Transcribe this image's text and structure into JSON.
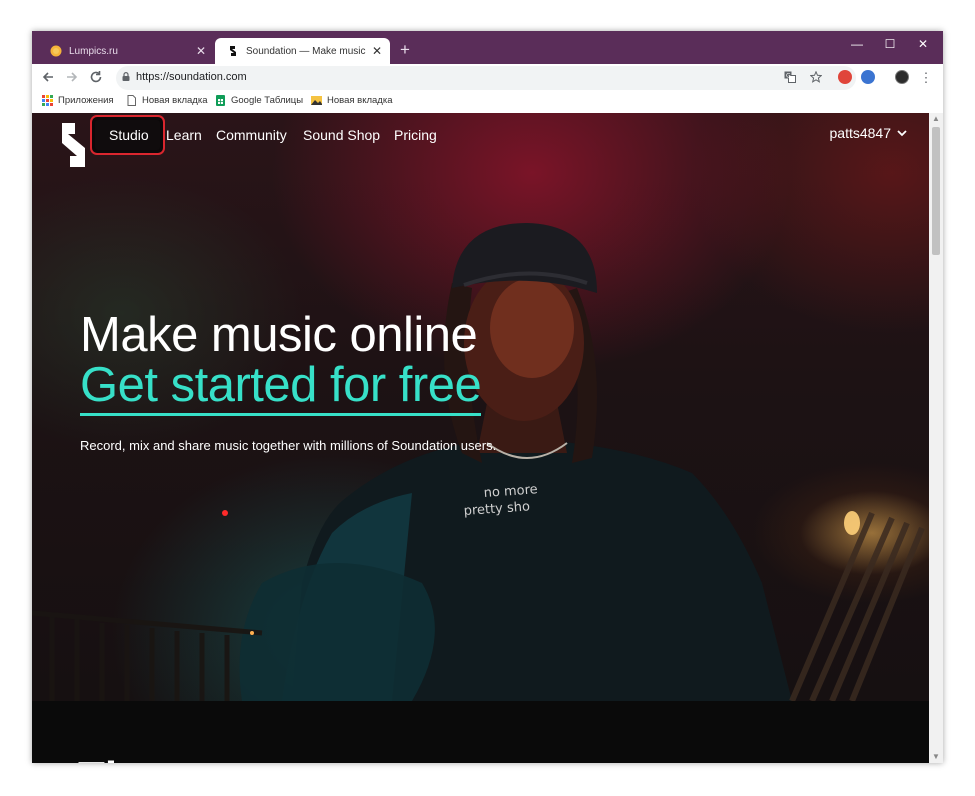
{
  "browser": {
    "tabs": [
      {
        "title": "Lumpics.ru",
        "close": "✕"
      },
      {
        "title": "Soundation — Make music online",
        "close": "✕"
      }
    ],
    "new_tab": "+",
    "window_controls": {
      "minimize": "—",
      "maximize": "☐",
      "close": "✕"
    },
    "url": "https://soundation.com",
    "bookmarks": [
      {
        "label": "Приложения",
        "icon": "apps-grid-icon"
      },
      {
        "label": "Новая вкладка",
        "icon": "page-icon"
      },
      {
        "label": "Google Таблицы",
        "icon": "sheets-icon"
      },
      {
        "label": "Новая вкладка",
        "icon": "image-icon"
      }
    ],
    "colors": {
      "tabstrip": "#5a2d59"
    }
  },
  "site": {
    "nav": [
      "Studio",
      "Learn",
      "Community",
      "Sound Shop",
      "Pricing"
    ],
    "user": "patts4847",
    "hero": {
      "headline": "Make music online",
      "cta": "Get started for free",
      "subtitle": "Record, mix and share music together with millions of Soundation users.",
      "shirt_text": "no more pretty sho..."
    },
    "next_section_heading": "The",
    "colors": {
      "accent": "#37e0c8",
      "highlight": "#d9262e"
    }
  }
}
